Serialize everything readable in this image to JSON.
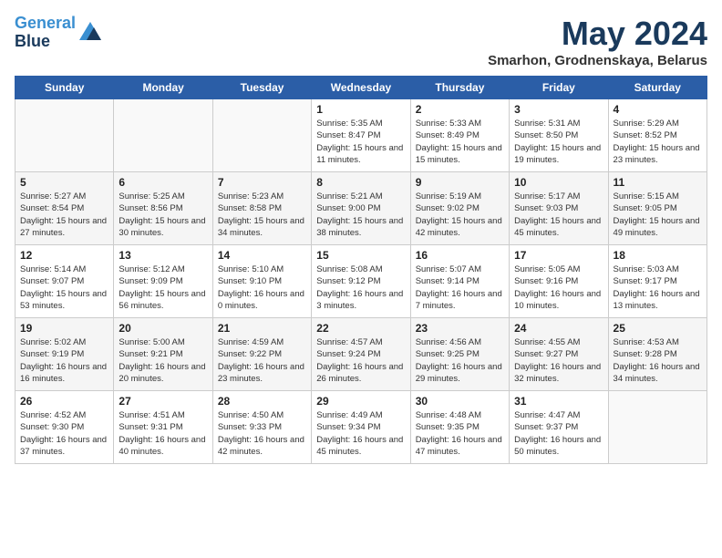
{
  "header": {
    "logo_line1": "General",
    "logo_line2": "Blue",
    "month": "May 2024",
    "location": "Smarhon, Grodnenskaya, Belarus"
  },
  "weekdays": [
    "Sunday",
    "Monday",
    "Tuesday",
    "Wednesday",
    "Thursday",
    "Friday",
    "Saturday"
  ],
  "weeks": [
    [
      {
        "day": "",
        "info": ""
      },
      {
        "day": "",
        "info": ""
      },
      {
        "day": "",
        "info": ""
      },
      {
        "day": "1",
        "info": "Sunrise: 5:35 AM\nSunset: 8:47 PM\nDaylight: 15 hours\nand 11 minutes."
      },
      {
        "day": "2",
        "info": "Sunrise: 5:33 AM\nSunset: 8:49 PM\nDaylight: 15 hours\nand 15 minutes."
      },
      {
        "day": "3",
        "info": "Sunrise: 5:31 AM\nSunset: 8:50 PM\nDaylight: 15 hours\nand 19 minutes."
      },
      {
        "day": "4",
        "info": "Sunrise: 5:29 AM\nSunset: 8:52 PM\nDaylight: 15 hours\nand 23 minutes."
      }
    ],
    [
      {
        "day": "5",
        "info": "Sunrise: 5:27 AM\nSunset: 8:54 PM\nDaylight: 15 hours\nand 27 minutes."
      },
      {
        "day": "6",
        "info": "Sunrise: 5:25 AM\nSunset: 8:56 PM\nDaylight: 15 hours\nand 30 minutes."
      },
      {
        "day": "7",
        "info": "Sunrise: 5:23 AM\nSunset: 8:58 PM\nDaylight: 15 hours\nand 34 minutes."
      },
      {
        "day": "8",
        "info": "Sunrise: 5:21 AM\nSunset: 9:00 PM\nDaylight: 15 hours\nand 38 minutes."
      },
      {
        "day": "9",
        "info": "Sunrise: 5:19 AM\nSunset: 9:02 PM\nDaylight: 15 hours\nand 42 minutes."
      },
      {
        "day": "10",
        "info": "Sunrise: 5:17 AM\nSunset: 9:03 PM\nDaylight: 15 hours\nand 45 minutes."
      },
      {
        "day": "11",
        "info": "Sunrise: 5:15 AM\nSunset: 9:05 PM\nDaylight: 15 hours\nand 49 minutes."
      }
    ],
    [
      {
        "day": "12",
        "info": "Sunrise: 5:14 AM\nSunset: 9:07 PM\nDaylight: 15 hours\nand 53 minutes."
      },
      {
        "day": "13",
        "info": "Sunrise: 5:12 AM\nSunset: 9:09 PM\nDaylight: 15 hours\nand 56 minutes."
      },
      {
        "day": "14",
        "info": "Sunrise: 5:10 AM\nSunset: 9:10 PM\nDaylight: 16 hours\nand 0 minutes."
      },
      {
        "day": "15",
        "info": "Sunrise: 5:08 AM\nSunset: 9:12 PM\nDaylight: 16 hours\nand 3 minutes."
      },
      {
        "day": "16",
        "info": "Sunrise: 5:07 AM\nSunset: 9:14 PM\nDaylight: 16 hours\nand 7 minutes."
      },
      {
        "day": "17",
        "info": "Sunrise: 5:05 AM\nSunset: 9:16 PM\nDaylight: 16 hours\nand 10 minutes."
      },
      {
        "day": "18",
        "info": "Sunrise: 5:03 AM\nSunset: 9:17 PM\nDaylight: 16 hours\nand 13 minutes."
      }
    ],
    [
      {
        "day": "19",
        "info": "Sunrise: 5:02 AM\nSunset: 9:19 PM\nDaylight: 16 hours\nand 16 minutes."
      },
      {
        "day": "20",
        "info": "Sunrise: 5:00 AM\nSunset: 9:21 PM\nDaylight: 16 hours\nand 20 minutes."
      },
      {
        "day": "21",
        "info": "Sunrise: 4:59 AM\nSunset: 9:22 PM\nDaylight: 16 hours\nand 23 minutes."
      },
      {
        "day": "22",
        "info": "Sunrise: 4:57 AM\nSunset: 9:24 PM\nDaylight: 16 hours\nand 26 minutes."
      },
      {
        "day": "23",
        "info": "Sunrise: 4:56 AM\nSunset: 9:25 PM\nDaylight: 16 hours\nand 29 minutes."
      },
      {
        "day": "24",
        "info": "Sunrise: 4:55 AM\nSunset: 9:27 PM\nDaylight: 16 hours\nand 32 minutes."
      },
      {
        "day": "25",
        "info": "Sunrise: 4:53 AM\nSunset: 9:28 PM\nDaylight: 16 hours\nand 34 minutes."
      }
    ],
    [
      {
        "day": "26",
        "info": "Sunrise: 4:52 AM\nSunset: 9:30 PM\nDaylight: 16 hours\nand 37 minutes."
      },
      {
        "day": "27",
        "info": "Sunrise: 4:51 AM\nSunset: 9:31 PM\nDaylight: 16 hours\nand 40 minutes."
      },
      {
        "day": "28",
        "info": "Sunrise: 4:50 AM\nSunset: 9:33 PM\nDaylight: 16 hours\nand 42 minutes."
      },
      {
        "day": "29",
        "info": "Sunrise: 4:49 AM\nSunset: 9:34 PM\nDaylight: 16 hours\nand 45 minutes."
      },
      {
        "day": "30",
        "info": "Sunrise: 4:48 AM\nSunset: 9:35 PM\nDaylight: 16 hours\nand 47 minutes."
      },
      {
        "day": "31",
        "info": "Sunrise: 4:47 AM\nSunset: 9:37 PM\nDaylight: 16 hours\nand 50 minutes."
      },
      {
        "day": "",
        "info": ""
      }
    ]
  ]
}
